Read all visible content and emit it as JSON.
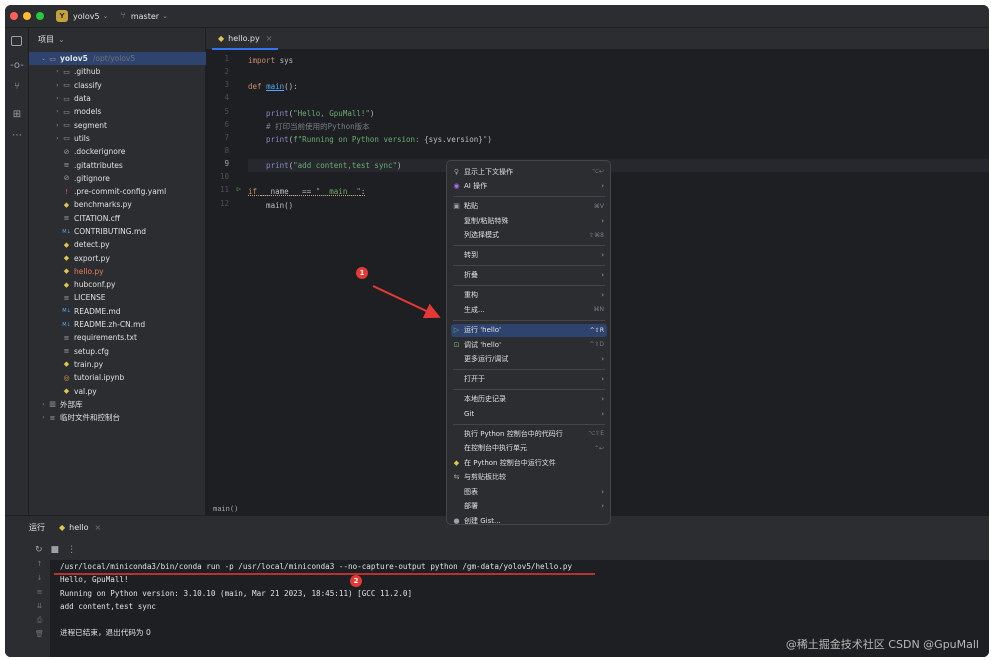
{
  "titlebar": {
    "project_badge": "Y",
    "project": "yolov5",
    "branch": "master"
  },
  "project_panel": {
    "title": "项目",
    "tree": [
      {
        "name": "yolov5",
        "path": "/opt/yolov5",
        "kind": "folder",
        "indent": 0,
        "open": true,
        "selected": true
      },
      {
        "name": ".github",
        "kind": "folder",
        "indent": 1
      },
      {
        "name": "classify",
        "kind": "folder",
        "indent": 1
      },
      {
        "name": "data",
        "kind": "folder",
        "indent": 1
      },
      {
        "name": "models",
        "kind": "folder",
        "indent": 1
      },
      {
        "name": "segment",
        "kind": "folder",
        "indent": 1
      },
      {
        "name": "utils",
        "kind": "folder",
        "indent": 1
      },
      {
        "name": ".dockerignore",
        "kind": "ignore",
        "indent": 1
      },
      {
        "name": ".gitattributes",
        "kind": "text",
        "indent": 1
      },
      {
        "name": ".gitignore",
        "kind": "ignore",
        "indent": 1
      },
      {
        "name": ".pre-commit-config.yaml",
        "kind": "yaml",
        "indent": 1
      },
      {
        "name": "benchmarks.py",
        "kind": "py",
        "indent": 1
      },
      {
        "name": "CITATION.cff",
        "kind": "text",
        "indent": 1
      },
      {
        "name": "CONTRIBUTING.md",
        "kind": "md",
        "indent": 1
      },
      {
        "name": "detect.py",
        "kind": "py",
        "indent": 1
      },
      {
        "name": "export.py",
        "kind": "py",
        "indent": 1
      },
      {
        "name": "hello.py",
        "kind": "py",
        "indent": 1,
        "highlight": true
      },
      {
        "name": "hubconf.py",
        "kind": "py",
        "indent": 1
      },
      {
        "name": "LICENSE",
        "kind": "text",
        "indent": 1
      },
      {
        "name": "README.md",
        "kind": "md",
        "indent": 1
      },
      {
        "name": "README.zh-CN.md",
        "kind": "md",
        "indent": 1
      },
      {
        "name": "requirements.txt",
        "kind": "text",
        "indent": 1
      },
      {
        "name": "setup.cfg",
        "kind": "text",
        "indent": 1
      },
      {
        "name": "train.py",
        "kind": "py",
        "indent": 1
      },
      {
        "name": "tutorial.ipynb",
        "kind": "nb",
        "indent": 1
      },
      {
        "name": "val.py",
        "kind": "py",
        "indent": 1
      },
      {
        "name": "外部库",
        "kind": "lib",
        "indent": 0
      },
      {
        "name": "临时文件和控制台",
        "kind": "scratch",
        "indent": 0
      }
    ]
  },
  "editor": {
    "tab": "hello.py",
    "line_numbers": [
      "1",
      "2",
      "3",
      "4",
      "5",
      "6",
      "7",
      "8",
      "9",
      "10",
      "11",
      "12"
    ],
    "lines": [
      [
        {
          "t": "import ",
          "c": "kw"
        },
        {
          "t": "sys",
          "c": ""
        }
      ],
      [],
      [
        {
          "t": "def ",
          "c": "kw"
        },
        {
          "t": "main",
          "c": "fn"
        },
        {
          "t": "():",
          "c": ""
        }
      ],
      [],
      [
        {
          "t": "    print",
          "c": "bi"
        },
        {
          "t": "(",
          "c": ""
        },
        {
          "t": "\"Hello, GpuMall!\"",
          "c": "str"
        },
        {
          "t": ")",
          "c": ""
        }
      ],
      [
        {
          "t": "    # 打印当前使用的Python版本",
          "c": "cm"
        }
      ],
      [
        {
          "t": "    print",
          "c": "bi"
        },
        {
          "t": "(",
          "c": ""
        },
        {
          "t": "f\"Running on Python version: ",
          "c": "str"
        },
        {
          "t": "{sys.version}",
          "c": ""
        },
        {
          "t": "\"",
          "c": "str"
        },
        {
          "t": ")",
          "c": ""
        }
      ],
      [],
      [
        {
          "t": "    print",
          "c": "bi"
        },
        {
          "t": "(",
          "c": ""
        },
        {
          "t": "\"add content,test sync\"",
          "c": "str"
        },
        {
          "t": ")",
          "c": ""
        }
      ],
      [],
      [
        {
          "t": "if ",
          "c": "kw"
        },
        {
          "t": "__name__",
          "c": ""
        },
        {
          "t": " == ",
          "c": ""
        },
        {
          "t": "\"__main__\"",
          "c": "str"
        },
        {
          "t": ":",
          "c": ""
        }
      ],
      [
        {
          "t": "    main",
          "c": ""
        },
        {
          "t": "()",
          "c": ""
        }
      ]
    ],
    "breadcrumb": "main()"
  },
  "context_menu": [
    {
      "icon": "lightbulb-icon",
      "glyph": "♀",
      "label": "显示上下文操作",
      "shortcut": "⌥↩"
    },
    {
      "icon": "ai-icon",
      "glyph": "◉",
      "label": "AI 操作",
      "submenu": true
    },
    {
      "sep": true
    },
    {
      "icon": "paste-icon",
      "glyph": "▣",
      "label": "粘贴",
      "shortcut": "⌘V"
    },
    {
      "label": "复制/粘贴特殊",
      "submenu": true
    },
    {
      "label": "列选择模式",
      "shortcut": "⇧⌘8"
    },
    {
      "sep": true
    },
    {
      "label": "转到",
      "submenu": true
    },
    {
      "sep": true
    },
    {
      "label": "折叠",
      "submenu": true
    },
    {
      "sep": true
    },
    {
      "label": "重构",
      "submenu": true
    },
    {
      "label": "生成...",
      "shortcut": "⌘N"
    },
    {
      "sep": true
    },
    {
      "icon": "run-icon",
      "glyph": "▷",
      "label": "运行 'hello'",
      "shortcut": "^⇧R",
      "highlight": true
    },
    {
      "icon": "debug-icon",
      "glyph": "⊡",
      "label": "调试 'hello'",
      "shortcut": "^⇧D"
    },
    {
      "label": "更多运行/调试",
      "submenu": true
    },
    {
      "sep": true
    },
    {
      "label": "打开于",
      "submenu": true
    },
    {
      "sep": true
    },
    {
      "label": "本地历史记录",
      "submenu": true
    },
    {
      "label": "Git",
      "submenu": true
    },
    {
      "sep": true
    },
    {
      "label": "执行 Python 控制台中的代码行",
      "shortcut": "⌥⇧E"
    },
    {
      "label": "在控制台中执行单元",
      "shortcut": "⌃↩"
    },
    {
      "icon": "python-icon",
      "glyph": "◆",
      "label": "在 Python 控制台中运行文件"
    },
    {
      "icon": "compare-icon",
      "glyph": "⇆",
      "label": "与剪贴板比较"
    },
    {
      "label": "图表",
      "submenu": true
    },
    {
      "label": "部署",
      "submenu": true
    },
    {
      "icon": "github-icon",
      "glyph": "●",
      "label": "创建 Gist..."
    }
  ],
  "run_panel": {
    "title": "运行",
    "tab": "hello",
    "console": [
      "/usr/local/miniconda3/bin/conda run -p /usr/local/miniconda3 --no-capture-output python /gm-data/yolov5/hello.py",
      "Hello, GpuMall!",
      "Running on Python version: 3.10.10 (main, Mar 21 2023, 18:45:11) [GCC 11.2.0]",
      "add content,test sync",
      "",
      "进程已结束，退出代码为 0"
    ]
  },
  "annotations": {
    "badge1": "1",
    "badge2": "2"
  },
  "watermark": "@稀土掘金技术社区 CSDN @GpuMall"
}
